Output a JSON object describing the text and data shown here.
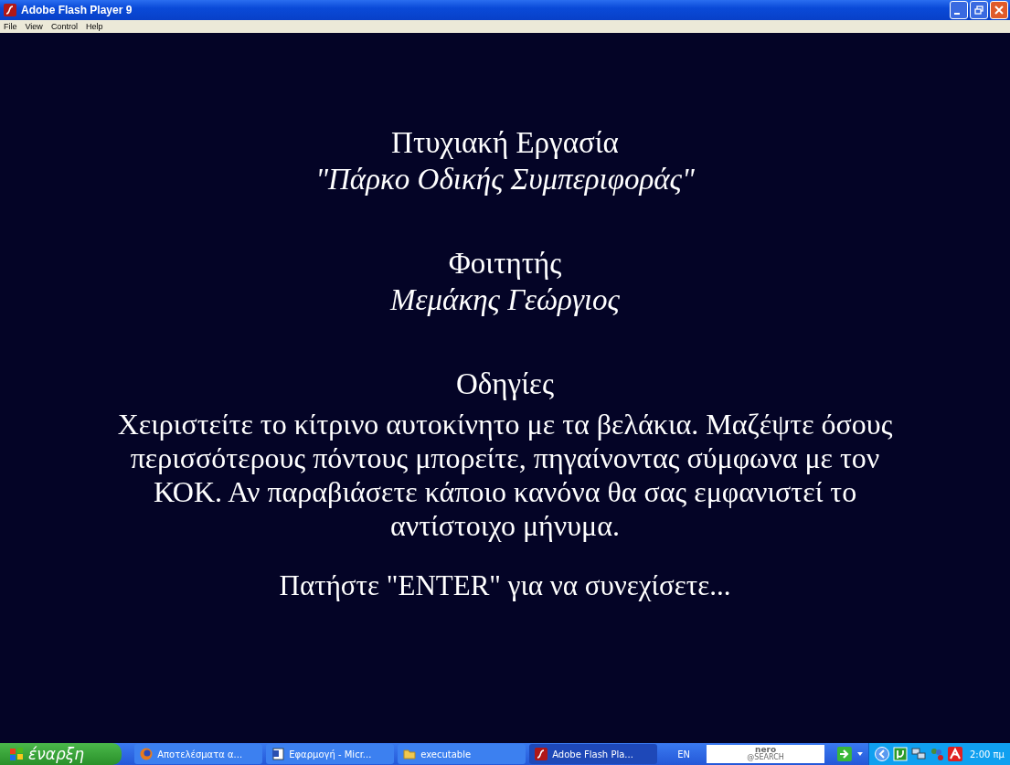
{
  "window": {
    "title": "Adobe Flash Player 9"
  },
  "menu": [
    "File",
    "View",
    "Control",
    "Help"
  ],
  "content": [
    {
      "lines": [
        {
          "kind": "heading",
          "text": "Πτυχιακή Εργασία"
        },
        {
          "kind": "emphasis",
          "text": "\"Πάρκο Οδικής Συμπεριφοράς\""
        }
      ]
    },
    {
      "lines": [
        {
          "kind": "heading",
          "text": "Φοιτητής"
        },
        {
          "kind": "emphasis",
          "text": "Μεμάκης Γεώργιος"
        }
      ]
    },
    {
      "lines": [
        {
          "kind": "heading",
          "text": "Οδηγίες"
        },
        {
          "kind": "paragraph",
          "text": "Χειριστείτε το κίτρινο αυτοκίνητο με τα βελάκια. Μαζέψτε όσους περισσότερους πόντους μπορείτε, πηγαίνοντας σύμφωνα με τον ΚΟΚ. Αν παραβιάσετε κάποιο κανόνα θα σας εμφανιστεί το αντίστοιχο μήνυμα."
        },
        {
          "kind": "prompt",
          "text": "Πατήστε \"ENTER\" για να συνεχίσετε..."
        }
      ]
    }
  ],
  "taskbar": {
    "start": "έναρξη",
    "tasks": [
      {
        "label": "Αποτελέσματα α...",
        "kind": "browser",
        "selected": false
      },
      {
        "label": "Εφαρμογή - Micr...",
        "kind": "document",
        "selected": false
      },
      {
        "label": "executable",
        "kind": "folder",
        "selected": false
      },
      {
        "label": "Adobe Flash Pla...",
        "kind": "flash",
        "selected": true
      }
    ],
    "language": "EN",
    "search": {
      "logo": "nero",
      "sub": "@SEARCH"
    },
    "clock": "2:00 πμ"
  }
}
